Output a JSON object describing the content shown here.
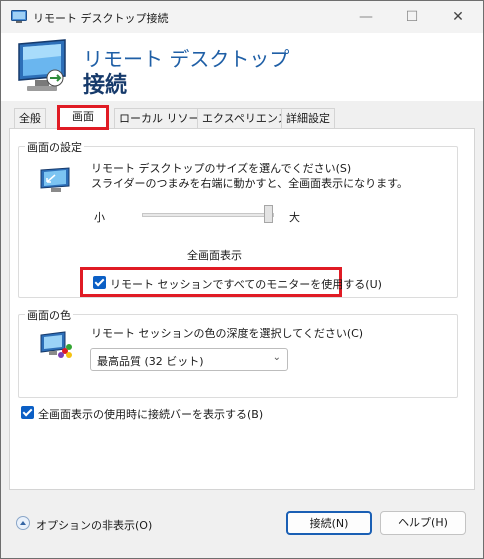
{
  "window": {
    "title": "リモート デスクトップ接続",
    "controls": {
      "minimize": "—",
      "maximize": "☐",
      "close": "✕"
    }
  },
  "banner": {
    "line1": "リモート デスクトップ",
    "line2": "接続"
  },
  "tabs": [
    {
      "label": "全般",
      "active": false
    },
    {
      "label": "画面",
      "active": true
    },
    {
      "label": "ローカル リソース",
      "active": false
    },
    {
      "label": "エクスペリエンス",
      "active": false
    },
    {
      "label": "詳細設定",
      "active": false
    }
  ],
  "display_settings": {
    "group_label": "画面の設定",
    "description": "リモート デスクトップのサイズを選んでください(S)\nスライダーのつまみを右端に動かすと、全画面表示になります。",
    "slider_small": "小",
    "slider_large": "大",
    "slider_level": 1.0,
    "fullscreen_label": "全画面表示",
    "use_all_monitors": {
      "label": "リモート セッションですべてのモニターを使用する(U)",
      "checked": true
    }
  },
  "colors": {
    "group_label": "画面の色",
    "description": "リモート セッションの色の深度を選択してください(C)",
    "selected": "最高品質 (32 ビット)"
  },
  "connection_bar": {
    "label": "全画面表示の使用時に接続バーを表示する(B)",
    "checked": true
  },
  "footer": {
    "options_label": "オプションの非表示(O)",
    "connect_label": "接続(N)",
    "help_label": "ヘルプ(H)"
  },
  "colors_theme": {
    "accent": "#1a5fb4",
    "highlight": "#e01b24",
    "checkbox": "#0b5fc5"
  },
  "icons": [
    "remote-desktop-icon",
    "monitor-icon",
    "color-palette-icon",
    "chevron-down-icon",
    "chevron-up-icon"
  ]
}
